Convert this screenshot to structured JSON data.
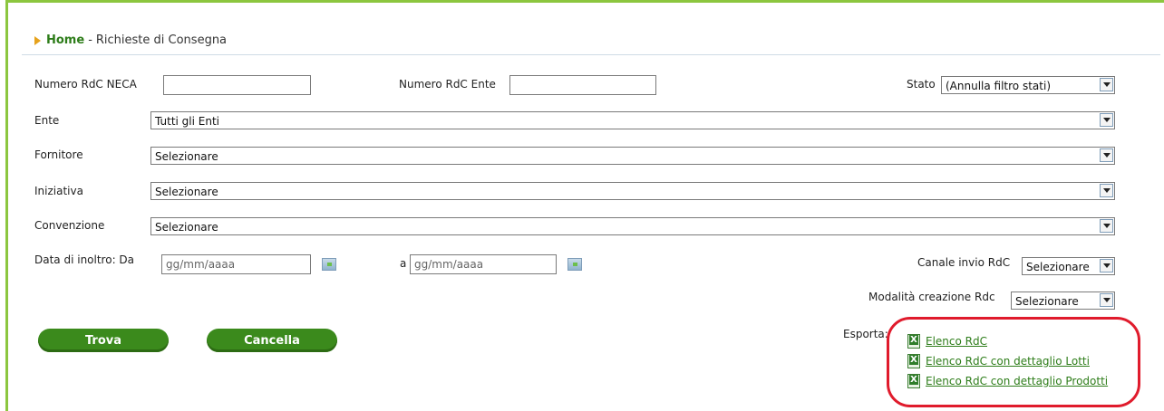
{
  "breadcrumb": {
    "home": "Home",
    "separator": "-",
    "current": "Richieste di Consegna"
  },
  "filters": {
    "numero_rdc_neca": {
      "label": "Numero RdC NECA",
      "value": ""
    },
    "numero_rdc_ente": {
      "label": "Numero RdC Ente",
      "value": ""
    },
    "stato": {
      "label": "Stato",
      "selected": "(Annulla filtro stati)"
    },
    "ente": {
      "label": "Ente",
      "selected": "Tutti gli Enti"
    },
    "fornitore": {
      "label": "Fornitore",
      "selected": "Selezionare"
    },
    "iniziativa": {
      "label": "Iniziativa",
      "selected": "Selezionare"
    },
    "convenzione": {
      "label": "Convenzione",
      "selected": "Selezionare"
    },
    "data_inoltro": {
      "label": "Data di inoltro: Da",
      "to_label": "a",
      "from_placeholder": "gg/mm/aaaa",
      "to_placeholder": "gg/mm/aaaa"
    },
    "canale_invio": {
      "label": "Canale invio RdC",
      "selected": "Selezionare"
    },
    "modalita_creazione": {
      "label": "Modalità creazione Rdc",
      "selected": "Selezionare"
    }
  },
  "buttons": {
    "trova": "Trova",
    "cancella": "Cancella"
  },
  "export": {
    "label": "Esporta:",
    "links": [
      {
        "label": "Elenco RdC",
        "icon": "excel-icon"
      },
      {
        "label": "Elenco RdC con dettaglio Lotti",
        "icon": "excel-icon"
      },
      {
        "label": "Elenco RdC con dettaglio Prodotti",
        "icon": "excel-icon"
      }
    ]
  },
  "colors": {
    "accent_green": "#8cc63f",
    "button_green": "#3b8a1c",
    "link_green": "#2e7d1a",
    "highlight_red": "#e01b2c"
  }
}
